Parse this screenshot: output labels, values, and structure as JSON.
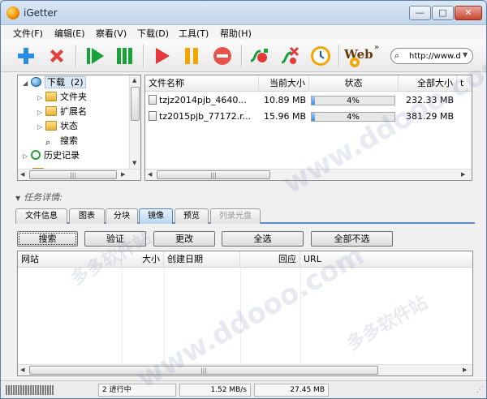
{
  "window": {
    "title": "iGetter",
    "controls": {
      "minimize": "—",
      "maximize": "□",
      "close": "✕"
    }
  },
  "menu": [
    "文件(F)",
    "编辑(E)",
    "察看(V)",
    "下载(D)",
    "工具(T)",
    "帮助(H)"
  ],
  "toolbar": {
    "icons": [
      "add-icon",
      "delete-icon",
      "start-icon",
      "start-all-icon",
      "resume-icon",
      "pause-icon",
      "stop-icon",
      "connect-icon",
      "disconnect-icon",
      "scheduler-icon",
      "web-icon"
    ],
    "more": "»",
    "web_label": "Web",
    "url_value": "http://www.dc"
  },
  "tree": {
    "items": [
      {
        "label": "下载",
        "count": "(2)"
      },
      {
        "label": "文件夹"
      },
      {
        "label": "扩展名"
      },
      {
        "label": "状态"
      },
      {
        "label": "搜索"
      },
      {
        "label": "历史记录"
      }
    ]
  },
  "files": {
    "columns": [
      "文件名称",
      "当前大小",
      "状态",
      "全部大小",
      "t"
    ],
    "rows": [
      {
        "name": "tzjz2014pjb_4640...",
        "current": "10.89 MB",
        "status": "4%",
        "progress": 0.04,
        "total": "232.33 MB"
      },
      {
        "name": "tz2015pjb_77172.r...",
        "current": "15.96 MB",
        "status": "4%",
        "progress": 0.04,
        "total": "381.29 MB"
      }
    ]
  },
  "details": {
    "title": "任务详情:"
  },
  "tabs": [
    "文件信息",
    "图表",
    "分块",
    "镜像",
    "预览",
    "列录光盘"
  ],
  "active_tab": "镜像",
  "mirror_buttons": [
    "搜索",
    "验证",
    "更改",
    "全选",
    "全部不选"
  ],
  "mirror_columns": [
    "网站",
    "大小",
    "创建日期",
    "回应",
    "URL"
  ],
  "status": {
    "tasks": "2 进行中",
    "speed": "1.52 MB/s",
    "downloaded": "27.45 MB"
  },
  "watermarks": [
    "多多软件站",
    "www.ddooo.com"
  ],
  "colors": {
    "accent": "#5b8bc4",
    "progress": "#3a8fde",
    "add": "#2a8ee0",
    "delete": "#e0413b",
    "start": "#1aa23a",
    "resume": "#e23a3a",
    "pause": "#f0a800"
  }
}
